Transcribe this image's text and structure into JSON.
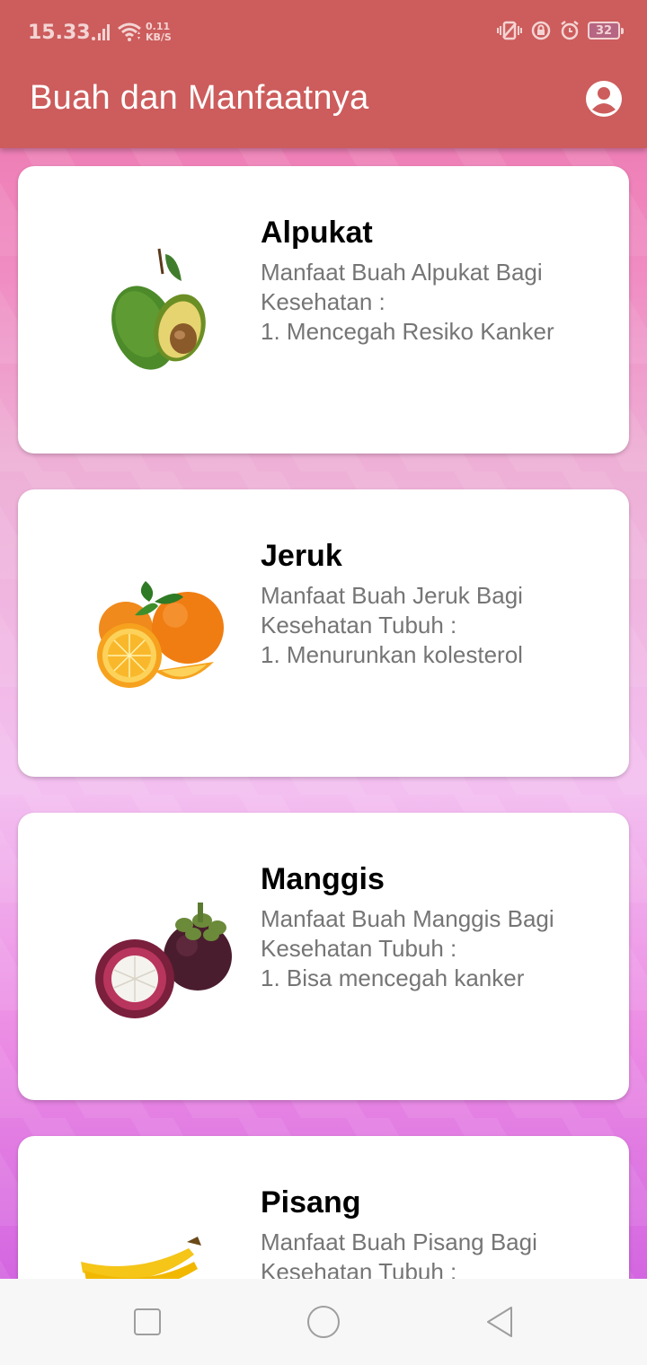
{
  "status_bar": {
    "time": "15.33",
    "net_speed_value": "0.11",
    "net_speed_unit": "KB/S",
    "battery": "32"
  },
  "app_bar": {
    "title": "Buah dan Manfaatnya",
    "account_icon": "account-circle-icon"
  },
  "fruits": [
    {
      "name": "Alpukat",
      "description": "Manfaat Buah Alpukat Bagi\nKesehatan :\n1.  Mencegah Resiko Kanker",
      "image": "avocado-image"
    },
    {
      "name": "Jeruk",
      "description": "Manfaat Buah Jeruk Bagi\nKesehatan Tubuh :\n1. Menurunkan kolesterol",
      "image": "orange-image"
    },
    {
      "name": "Manggis",
      "description": "Manfaat Buah Manggis Bagi\nKesehatan Tubuh :\n1. Bisa mencegah kanker",
      "image": "mangosteen-image"
    },
    {
      "name": "Pisang",
      "description": "Manfaat Buah Pisang Bagi\nKesehatan Tubuh :",
      "image": "banana-image"
    }
  ],
  "colors": {
    "app_bar": "#cd5c5c",
    "card": "#ffffff",
    "title_text": "#000000",
    "desc_text": "#757575"
  }
}
